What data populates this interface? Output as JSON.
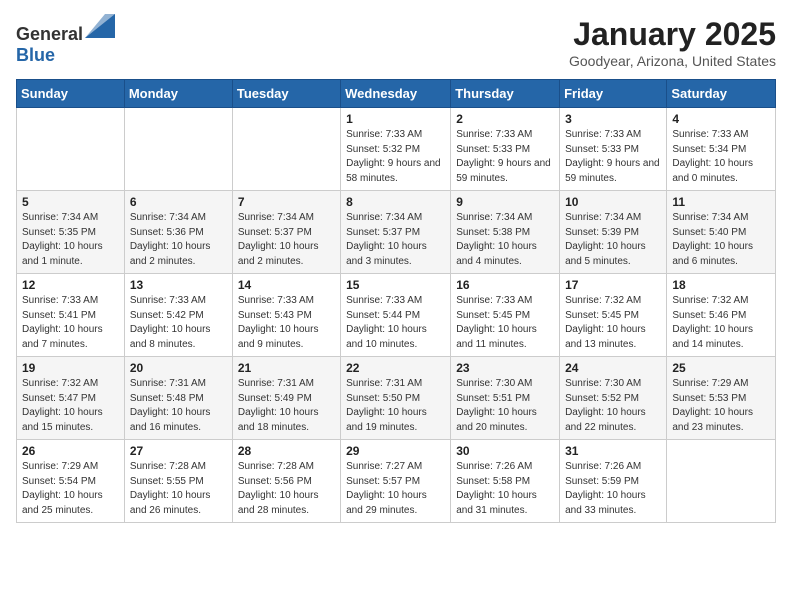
{
  "logo": {
    "general": "General",
    "blue": "Blue"
  },
  "title": "January 2025",
  "subtitle": "Goodyear, Arizona, United States",
  "headers": [
    "Sunday",
    "Monday",
    "Tuesday",
    "Wednesday",
    "Thursday",
    "Friday",
    "Saturday"
  ],
  "weeks": [
    [
      {
        "day": "",
        "sunrise": "",
        "sunset": "",
        "daylight": ""
      },
      {
        "day": "",
        "sunrise": "",
        "sunset": "",
        "daylight": ""
      },
      {
        "day": "",
        "sunrise": "",
        "sunset": "",
        "daylight": ""
      },
      {
        "day": "1",
        "sunrise": "Sunrise: 7:33 AM",
        "sunset": "Sunset: 5:32 PM",
        "daylight": "Daylight: 9 hours and 58 minutes."
      },
      {
        "day": "2",
        "sunrise": "Sunrise: 7:33 AM",
        "sunset": "Sunset: 5:33 PM",
        "daylight": "Daylight: 9 hours and 59 minutes."
      },
      {
        "day": "3",
        "sunrise": "Sunrise: 7:33 AM",
        "sunset": "Sunset: 5:33 PM",
        "daylight": "Daylight: 9 hours and 59 minutes."
      },
      {
        "day": "4",
        "sunrise": "Sunrise: 7:33 AM",
        "sunset": "Sunset: 5:34 PM",
        "daylight": "Daylight: 10 hours and 0 minutes."
      }
    ],
    [
      {
        "day": "5",
        "sunrise": "Sunrise: 7:34 AM",
        "sunset": "Sunset: 5:35 PM",
        "daylight": "Daylight: 10 hours and 1 minute."
      },
      {
        "day": "6",
        "sunrise": "Sunrise: 7:34 AM",
        "sunset": "Sunset: 5:36 PM",
        "daylight": "Daylight: 10 hours and 2 minutes."
      },
      {
        "day": "7",
        "sunrise": "Sunrise: 7:34 AM",
        "sunset": "Sunset: 5:37 PM",
        "daylight": "Daylight: 10 hours and 2 minutes."
      },
      {
        "day": "8",
        "sunrise": "Sunrise: 7:34 AM",
        "sunset": "Sunset: 5:37 PM",
        "daylight": "Daylight: 10 hours and 3 minutes."
      },
      {
        "day": "9",
        "sunrise": "Sunrise: 7:34 AM",
        "sunset": "Sunset: 5:38 PM",
        "daylight": "Daylight: 10 hours and 4 minutes."
      },
      {
        "day": "10",
        "sunrise": "Sunrise: 7:34 AM",
        "sunset": "Sunset: 5:39 PM",
        "daylight": "Daylight: 10 hours and 5 minutes."
      },
      {
        "day": "11",
        "sunrise": "Sunrise: 7:34 AM",
        "sunset": "Sunset: 5:40 PM",
        "daylight": "Daylight: 10 hours and 6 minutes."
      }
    ],
    [
      {
        "day": "12",
        "sunrise": "Sunrise: 7:33 AM",
        "sunset": "Sunset: 5:41 PM",
        "daylight": "Daylight: 10 hours and 7 minutes."
      },
      {
        "day": "13",
        "sunrise": "Sunrise: 7:33 AM",
        "sunset": "Sunset: 5:42 PM",
        "daylight": "Daylight: 10 hours and 8 minutes."
      },
      {
        "day": "14",
        "sunrise": "Sunrise: 7:33 AM",
        "sunset": "Sunset: 5:43 PM",
        "daylight": "Daylight: 10 hours and 9 minutes."
      },
      {
        "day": "15",
        "sunrise": "Sunrise: 7:33 AM",
        "sunset": "Sunset: 5:44 PM",
        "daylight": "Daylight: 10 hours and 10 minutes."
      },
      {
        "day": "16",
        "sunrise": "Sunrise: 7:33 AM",
        "sunset": "Sunset: 5:45 PM",
        "daylight": "Daylight: 10 hours and 11 minutes."
      },
      {
        "day": "17",
        "sunrise": "Sunrise: 7:32 AM",
        "sunset": "Sunset: 5:45 PM",
        "daylight": "Daylight: 10 hours and 13 minutes."
      },
      {
        "day": "18",
        "sunrise": "Sunrise: 7:32 AM",
        "sunset": "Sunset: 5:46 PM",
        "daylight": "Daylight: 10 hours and 14 minutes."
      }
    ],
    [
      {
        "day": "19",
        "sunrise": "Sunrise: 7:32 AM",
        "sunset": "Sunset: 5:47 PM",
        "daylight": "Daylight: 10 hours and 15 minutes."
      },
      {
        "day": "20",
        "sunrise": "Sunrise: 7:31 AM",
        "sunset": "Sunset: 5:48 PM",
        "daylight": "Daylight: 10 hours and 16 minutes."
      },
      {
        "day": "21",
        "sunrise": "Sunrise: 7:31 AM",
        "sunset": "Sunset: 5:49 PM",
        "daylight": "Daylight: 10 hours and 18 minutes."
      },
      {
        "day": "22",
        "sunrise": "Sunrise: 7:31 AM",
        "sunset": "Sunset: 5:50 PM",
        "daylight": "Daylight: 10 hours and 19 minutes."
      },
      {
        "day": "23",
        "sunrise": "Sunrise: 7:30 AM",
        "sunset": "Sunset: 5:51 PM",
        "daylight": "Daylight: 10 hours and 20 minutes."
      },
      {
        "day": "24",
        "sunrise": "Sunrise: 7:30 AM",
        "sunset": "Sunset: 5:52 PM",
        "daylight": "Daylight: 10 hours and 22 minutes."
      },
      {
        "day": "25",
        "sunrise": "Sunrise: 7:29 AM",
        "sunset": "Sunset: 5:53 PM",
        "daylight": "Daylight: 10 hours and 23 minutes."
      }
    ],
    [
      {
        "day": "26",
        "sunrise": "Sunrise: 7:29 AM",
        "sunset": "Sunset: 5:54 PM",
        "daylight": "Daylight: 10 hours and 25 minutes."
      },
      {
        "day": "27",
        "sunrise": "Sunrise: 7:28 AM",
        "sunset": "Sunset: 5:55 PM",
        "daylight": "Daylight: 10 hours and 26 minutes."
      },
      {
        "day": "28",
        "sunrise": "Sunrise: 7:28 AM",
        "sunset": "Sunset: 5:56 PM",
        "daylight": "Daylight: 10 hours and 28 minutes."
      },
      {
        "day": "29",
        "sunrise": "Sunrise: 7:27 AM",
        "sunset": "Sunset: 5:57 PM",
        "daylight": "Daylight: 10 hours and 29 minutes."
      },
      {
        "day": "30",
        "sunrise": "Sunrise: 7:26 AM",
        "sunset": "Sunset: 5:58 PM",
        "daylight": "Daylight: 10 hours and 31 minutes."
      },
      {
        "day": "31",
        "sunrise": "Sunrise: 7:26 AM",
        "sunset": "Sunset: 5:59 PM",
        "daylight": "Daylight: 10 hours and 33 minutes."
      },
      {
        "day": "",
        "sunrise": "",
        "sunset": "",
        "daylight": ""
      }
    ]
  ]
}
